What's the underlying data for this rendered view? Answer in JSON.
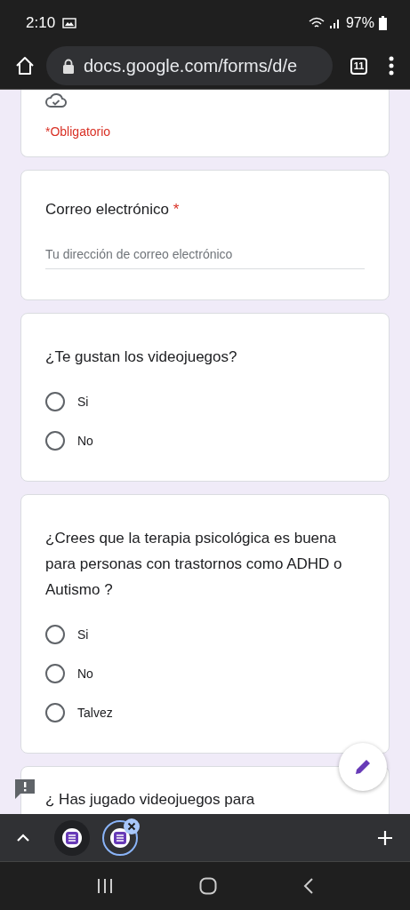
{
  "status_bar": {
    "time": "2:10",
    "battery": "97%"
  },
  "browser": {
    "url": "docs.google.com/forms/d/e",
    "tab_count": "11"
  },
  "form": {
    "required_note": "*Obligatorio",
    "email": {
      "label": "Correo electrónico",
      "required_mark": "*",
      "placeholder": "Tu dirección de correo electrónico"
    },
    "questions": [
      {
        "title": "¿Te gustan los videojuegos?",
        "options": [
          {
            "label": "Si",
            "selected": false
          },
          {
            "label": "No",
            "selected": false
          }
        ]
      },
      {
        "title": "¿Crees que la terapia psicológica es buena para personas con trastornos como ADHD o Autismo ?",
        "options": [
          {
            "label": "Si",
            "selected": false
          },
          {
            "label": "No",
            "selected": false
          },
          {
            "label": "Talvez",
            "selected": false
          }
        ]
      },
      {
        "title": "¿ Has jugado videojuegos para"
      }
    ]
  },
  "tab_strip": {
    "tabs": [
      {
        "selected": false
      },
      {
        "selected": true
      }
    ]
  }
}
